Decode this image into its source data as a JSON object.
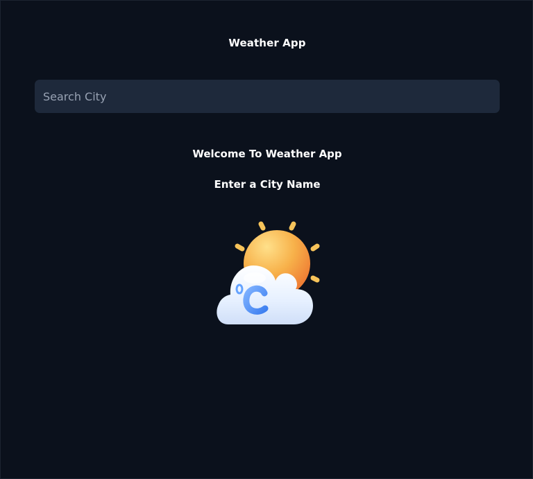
{
  "header": {
    "title": "Weather App"
  },
  "search": {
    "placeholder": "Search City",
    "value": ""
  },
  "main": {
    "welcome": "Welcome To Weather App",
    "prompt": "Enter a City Name",
    "illustration_icon": "sun-cloud-celsius-icon"
  },
  "colors": {
    "background": "#0b111c",
    "search_background": "#1e293b",
    "text": "#ffffff",
    "placeholder": "#98a2b3",
    "sun_start": "#ffd36a",
    "sun_end": "#f28a3b",
    "cloud": "#e8f2ff",
    "celsius": "#4f8ff7"
  }
}
